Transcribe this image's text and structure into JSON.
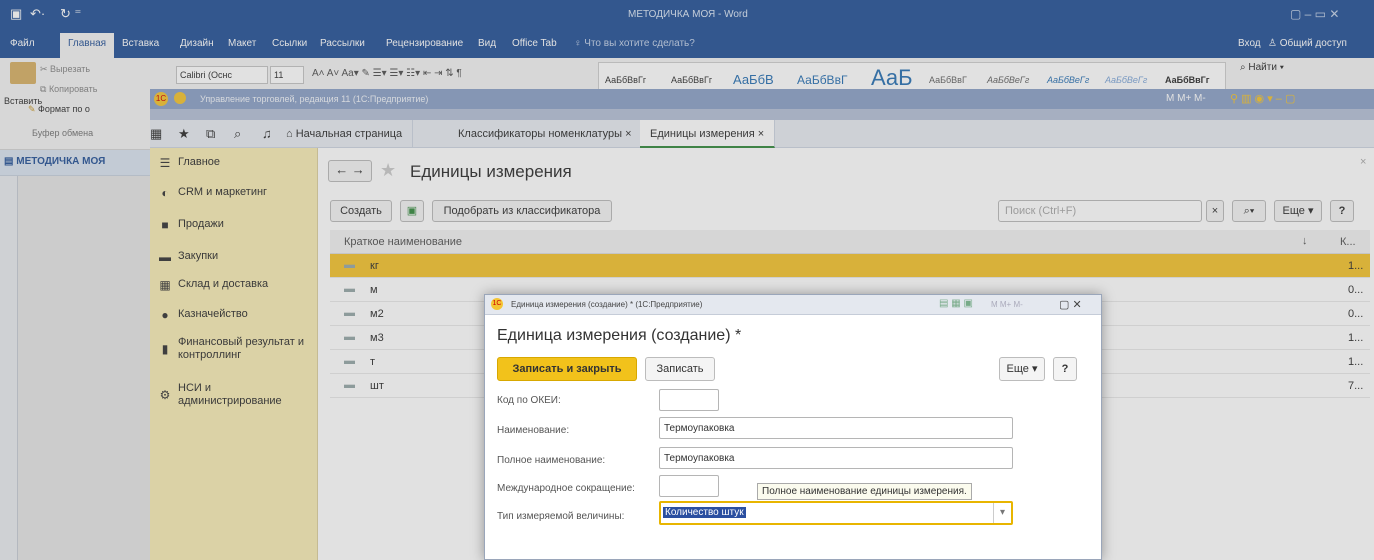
{
  "word": {
    "title": "МЕТОДИЧКА МОЯ - Word",
    "tabs": [
      "Файл",
      "Главная",
      "Вставка",
      "Дизайн",
      "Макет",
      "Ссылки",
      "Рассылки",
      "Рецензирование",
      "Вид",
      "Office Tab"
    ],
    "tell_me": "Что вы хотите сделать?",
    "login": "Вход",
    "share": "Общий доступ",
    "clipboard": {
      "paste": "Вставить",
      "cut": "Вырезать",
      "copy": "Копировать",
      "format": "Формат по о",
      "group": "Буфер обмена"
    },
    "font_name": "Calibri (Оснс",
    "font_size": "11",
    "styles": [
      "АаБбВвГг",
      "АаБбВвГг",
      "АаБбВ",
      "АаБбВвГ",
      "АаБ",
      "АаБбВвГ",
      "АаБбВеГг",
      "АаБбВеГг",
      "АаБбВеГг",
      "АаБбВвГг"
    ],
    "find": "Найти",
    "nav_title": "МЕТОДИЧКА МОЯ"
  },
  "onec": {
    "title": "Управление торговлей, редакция 11 (1С:Предприятие)",
    "header_status": "M  M+  M-",
    "tabs": [
      "Начальная страница",
      "Классификаторы номенклатуры ×",
      "Единицы измерения ×"
    ],
    "sections": [
      {
        "icon": "menu-icon",
        "label": "Главное"
      },
      {
        "icon": "crm-icon",
        "label": "CRM и маркетинг"
      },
      {
        "icon": "bag-icon",
        "label": "Продажи"
      },
      {
        "icon": "cart-icon",
        "label": "Закупки"
      },
      {
        "icon": "warehouse-icon",
        "label": "Склад и доставка"
      },
      {
        "icon": "treasury-icon",
        "label": "Казначейство"
      },
      {
        "icon": "chart-icon",
        "label": "Финансовый результат и контроллинг"
      },
      {
        "icon": "gear-icon",
        "label": "НСИ и администрирование"
      }
    ],
    "page_title": "Единицы измерения",
    "toolbar": {
      "create": "Создать",
      "pick": "Подобрать из классификатора",
      "search_placeholder": "Поиск (Ctrl+F)",
      "more": "Еще",
      "help": "?"
    },
    "columns": {
      "name": "Краткое наименование",
      "code": "К..."
    },
    "rows": [
      {
        "name": "кг",
        "code": "1..."
      },
      {
        "name": "м",
        "code": "0..."
      },
      {
        "name": "м2",
        "code": "0..."
      },
      {
        "name": "м3",
        "code": "1..."
      },
      {
        "name": "т",
        "code": "1..."
      },
      {
        "name": "шт",
        "code": "7..."
      }
    ],
    "accent": "#f4c534"
  },
  "modal": {
    "title": "Единица измерения (создание) * (1С:Предприятие)",
    "window_controls": "M  M+  M-",
    "heading": "Единица измерения (создание) *",
    "save_close": "Записать и закрыть",
    "save": "Записать",
    "more": "Еще",
    "help": "?",
    "fields": {
      "okei_label": "Код по ОКЕИ:",
      "okei_value": "",
      "name_label": "Наименование:",
      "name_value": "Термоупаковка",
      "full_label": "Полное наименование:",
      "full_value": "Термоупаковка",
      "intl_label": "Международное сокращение:",
      "intl_value": "",
      "type_label": "Тип измеряемой величины:",
      "type_value": "Количество штук"
    },
    "tooltip": "Полное наименование единицы измерения."
  }
}
